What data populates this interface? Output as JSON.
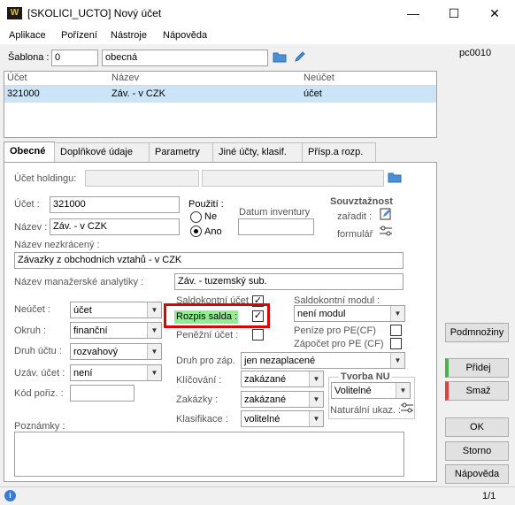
{
  "window": {
    "title": "[SKOLICI_UCTO] Nový účet",
    "app_logo": "W",
    "minimize": "—",
    "maximize": "☐",
    "close": "✕"
  },
  "menu": [
    "Aplikace",
    "Pořízení",
    "Nástroje",
    "Nápověda"
  ],
  "sablona": {
    "label": "Šablona :",
    "code": "0",
    "name": "obecná"
  },
  "user_code": "pc0010",
  "grid": {
    "columns": [
      "Účet",
      "Název",
      "Neúčet"
    ],
    "rows": [
      {
        "ucet": "321000",
        "nazev": "Záv. - v CZK",
        "neucet": "účet"
      }
    ]
  },
  "tabs": [
    "Obecné",
    "Doplňkové údaje",
    "Parametry",
    "Jiné účty, klasif.",
    "Přísp.a rozp."
  ],
  "form": {
    "ucet_holdingu_label": "Účet holdingu:",
    "ucet_label": "Účet :",
    "ucet_value": "321000",
    "nazev_label": "Název :",
    "nazev_value": "Záv. - v CZK",
    "pouziti_label": "Použití :",
    "pouziti_ne": "Ne",
    "pouziti_ano": "Ano",
    "datum_inventury_label": "Datum inventury",
    "souvztaznost_label": "Souvztažnost",
    "zaradit_label": "zařadit :",
    "formular_label": "formulář",
    "nazev_nezkraceny_label": "Název nezkrácený :",
    "nazev_nezkraceny_value": "Závazky z obchodních vztahů - v CZK",
    "manazerska_label": "Název manažerské analytiky :",
    "manazerska_value": "Záv. - tuzemský sub.",
    "neucet_label": "Neúčet :",
    "neucet_value": "účet",
    "saldokontni_ucet_label": "Saldokontní účet :",
    "saldokontni_modul_label": "Saldokontní modul :",
    "saldokontni_modul_value": "není modul",
    "okruh_label": "Okruh :",
    "okruh_value": "finanční",
    "rozpis_salda_label": "Rozpis salda :",
    "penezni_ucet_label": "Peněžní účet :",
    "penize_pe_label": "Peníze pro PE(CF)",
    "zapocet_pe_label": "Zápočet pro PE (CF)",
    "druh_uctu_label": "Druh účtu :",
    "druh_uctu_value": "rozvahový",
    "druh_pro_zap_label": "Druh pro záp.",
    "druh_pro_zap_value": "jen nezaplacené",
    "uzav_ucet_label": "Uzáv. účet :",
    "uzav_ucet_value": "není",
    "klicovani_label": "Klíčování :",
    "klicovani_value": "zakázané",
    "tvorba_nu_label": "Tvorba NU",
    "tvorba_nu_value": "Volitelné",
    "kod_poriz_label": "Kód pořiz. :",
    "zakazky_label": "Zakázky :",
    "zakazky_value": "zakázané",
    "naturalni_label": "Naturální ukaz. :",
    "klasifikace_label": "Klasifikace :",
    "klasifikace_value": "volitelné",
    "poznamky_label": "Poznámky :"
  },
  "buttons": {
    "podmnoziny": "Podmnožiny",
    "pridej": "Přidej",
    "smaz": "Smaž",
    "ok": "OK",
    "storno": "Storno",
    "napoveda": "Nápověda"
  },
  "status": {
    "page": "1/1",
    "info": "i"
  }
}
